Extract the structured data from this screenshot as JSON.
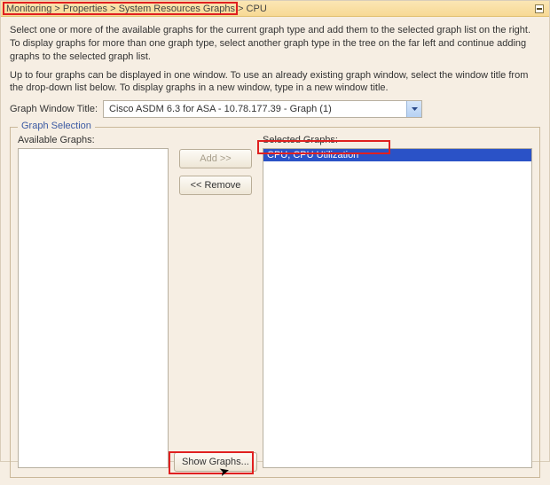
{
  "titlebar": {
    "breadcrumb": "Monitoring > Properties > System Resources Graphs > CPU"
  },
  "instructions": {
    "para1": "Select one or more of the available graphs for the current graph type and add them to the selected graph list on the right. To display graphs for more than one graph type, select another graph type in the tree on the far left and continue adding graphs to the selected graph list.",
    "para2": "Up to four graphs can be displayed in one window. To use an already existing graph window, select the window title from the drop-down list below. To display graphs in a new window, type in a new window title."
  },
  "windowTitle": {
    "label": "Graph Window Title:",
    "value": "Cisco ASDM 6.3 for ASA - 10.78.177.39 - Graph (1)"
  },
  "fieldset": {
    "legend": "Graph Selection",
    "availableLabel": "Available Graphs:",
    "selectedLabel": "Selected Graphs:"
  },
  "buttons": {
    "add": "Add >>",
    "remove": "<< Remove",
    "show": "Show Graphs..."
  },
  "available": {
    "items": []
  },
  "selected": {
    "items": [
      {
        "label": "CPU, CPU Utilization",
        "selected": true
      }
    ]
  }
}
